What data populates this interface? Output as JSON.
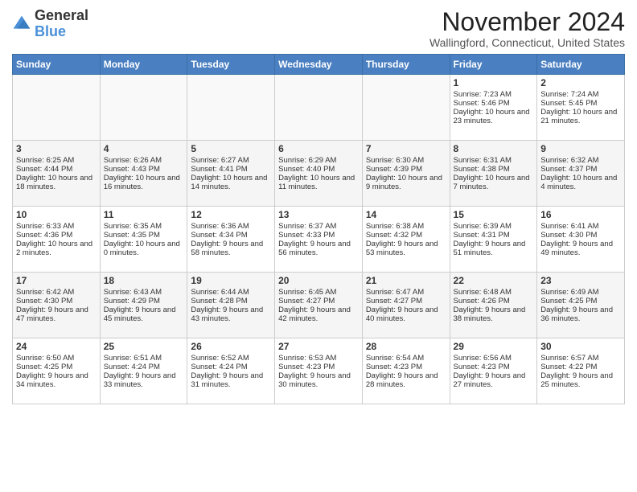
{
  "logo": {
    "general": "General",
    "blue": "Blue"
  },
  "header": {
    "title": "November 2024",
    "subtitle": "Wallingford, Connecticut, United States"
  },
  "weekdays": [
    "Sunday",
    "Monday",
    "Tuesday",
    "Wednesday",
    "Thursday",
    "Friday",
    "Saturday"
  ],
  "weeks": [
    [
      {
        "day": "",
        "sunrise": "",
        "sunset": "",
        "daylight": ""
      },
      {
        "day": "",
        "sunrise": "",
        "sunset": "",
        "daylight": ""
      },
      {
        "day": "",
        "sunrise": "",
        "sunset": "",
        "daylight": ""
      },
      {
        "day": "",
        "sunrise": "",
        "sunset": "",
        "daylight": ""
      },
      {
        "day": "",
        "sunrise": "",
        "sunset": "",
        "daylight": ""
      },
      {
        "day": "1",
        "sunrise": "Sunrise: 7:23 AM",
        "sunset": "Sunset: 5:46 PM",
        "daylight": "Daylight: 10 hours and 23 minutes."
      },
      {
        "day": "2",
        "sunrise": "Sunrise: 7:24 AM",
        "sunset": "Sunset: 5:45 PM",
        "daylight": "Daylight: 10 hours and 21 minutes."
      }
    ],
    [
      {
        "day": "3",
        "sunrise": "Sunrise: 6:25 AM",
        "sunset": "Sunset: 4:44 PM",
        "daylight": "Daylight: 10 hours and 18 minutes."
      },
      {
        "day": "4",
        "sunrise": "Sunrise: 6:26 AM",
        "sunset": "Sunset: 4:43 PM",
        "daylight": "Daylight: 10 hours and 16 minutes."
      },
      {
        "day": "5",
        "sunrise": "Sunrise: 6:27 AM",
        "sunset": "Sunset: 4:41 PM",
        "daylight": "Daylight: 10 hours and 14 minutes."
      },
      {
        "day": "6",
        "sunrise": "Sunrise: 6:29 AM",
        "sunset": "Sunset: 4:40 PM",
        "daylight": "Daylight: 10 hours and 11 minutes."
      },
      {
        "day": "7",
        "sunrise": "Sunrise: 6:30 AM",
        "sunset": "Sunset: 4:39 PM",
        "daylight": "Daylight: 10 hours and 9 minutes."
      },
      {
        "day": "8",
        "sunrise": "Sunrise: 6:31 AM",
        "sunset": "Sunset: 4:38 PM",
        "daylight": "Daylight: 10 hours and 7 minutes."
      },
      {
        "day": "9",
        "sunrise": "Sunrise: 6:32 AM",
        "sunset": "Sunset: 4:37 PM",
        "daylight": "Daylight: 10 hours and 4 minutes."
      }
    ],
    [
      {
        "day": "10",
        "sunrise": "Sunrise: 6:33 AM",
        "sunset": "Sunset: 4:36 PM",
        "daylight": "Daylight: 10 hours and 2 minutes."
      },
      {
        "day": "11",
        "sunrise": "Sunrise: 6:35 AM",
        "sunset": "Sunset: 4:35 PM",
        "daylight": "Daylight: 10 hours and 0 minutes."
      },
      {
        "day": "12",
        "sunrise": "Sunrise: 6:36 AM",
        "sunset": "Sunset: 4:34 PM",
        "daylight": "Daylight: 9 hours and 58 minutes."
      },
      {
        "day": "13",
        "sunrise": "Sunrise: 6:37 AM",
        "sunset": "Sunset: 4:33 PM",
        "daylight": "Daylight: 9 hours and 56 minutes."
      },
      {
        "day": "14",
        "sunrise": "Sunrise: 6:38 AM",
        "sunset": "Sunset: 4:32 PM",
        "daylight": "Daylight: 9 hours and 53 minutes."
      },
      {
        "day": "15",
        "sunrise": "Sunrise: 6:39 AM",
        "sunset": "Sunset: 4:31 PM",
        "daylight": "Daylight: 9 hours and 51 minutes."
      },
      {
        "day": "16",
        "sunrise": "Sunrise: 6:41 AM",
        "sunset": "Sunset: 4:30 PM",
        "daylight": "Daylight: 9 hours and 49 minutes."
      }
    ],
    [
      {
        "day": "17",
        "sunrise": "Sunrise: 6:42 AM",
        "sunset": "Sunset: 4:30 PM",
        "daylight": "Daylight: 9 hours and 47 minutes."
      },
      {
        "day": "18",
        "sunrise": "Sunrise: 6:43 AM",
        "sunset": "Sunset: 4:29 PM",
        "daylight": "Daylight: 9 hours and 45 minutes."
      },
      {
        "day": "19",
        "sunrise": "Sunrise: 6:44 AM",
        "sunset": "Sunset: 4:28 PM",
        "daylight": "Daylight: 9 hours and 43 minutes."
      },
      {
        "day": "20",
        "sunrise": "Sunrise: 6:45 AM",
        "sunset": "Sunset: 4:27 PM",
        "daylight": "Daylight: 9 hours and 42 minutes."
      },
      {
        "day": "21",
        "sunrise": "Sunrise: 6:47 AM",
        "sunset": "Sunset: 4:27 PM",
        "daylight": "Daylight: 9 hours and 40 minutes."
      },
      {
        "day": "22",
        "sunrise": "Sunrise: 6:48 AM",
        "sunset": "Sunset: 4:26 PM",
        "daylight": "Daylight: 9 hours and 38 minutes."
      },
      {
        "day": "23",
        "sunrise": "Sunrise: 6:49 AM",
        "sunset": "Sunset: 4:25 PM",
        "daylight": "Daylight: 9 hours and 36 minutes."
      }
    ],
    [
      {
        "day": "24",
        "sunrise": "Sunrise: 6:50 AM",
        "sunset": "Sunset: 4:25 PM",
        "daylight": "Daylight: 9 hours and 34 minutes."
      },
      {
        "day": "25",
        "sunrise": "Sunrise: 6:51 AM",
        "sunset": "Sunset: 4:24 PM",
        "daylight": "Daylight: 9 hours and 33 minutes."
      },
      {
        "day": "26",
        "sunrise": "Sunrise: 6:52 AM",
        "sunset": "Sunset: 4:24 PM",
        "daylight": "Daylight: 9 hours and 31 minutes."
      },
      {
        "day": "27",
        "sunrise": "Sunrise: 6:53 AM",
        "sunset": "Sunset: 4:23 PM",
        "daylight": "Daylight: 9 hours and 30 minutes."
      },
      {
        "day": "28",
        "sunrise": "Sunrise: 6:54 AM",
        "sunset": "Sunset: 4:23 PM",
        "daylight": "Daylight: 9 hours and 28 minutes."
      },
      {
        "day": "29",
        "sunrise": "Sunrise: 6:56 AM",
        "sunset": "Sunset: 4:23 PM",
        "daylight": "Daylight: 9 hours and 27 minutes."
      },
      {
        "day": "30",
        "sunrise": "Sunrise: 6:57 AM",
        "sunset": "Sunset: 4:22 PM",
        "daylight": "Daylight: 9 hours and 25 minutes."
      }
    ]
  ]
}
